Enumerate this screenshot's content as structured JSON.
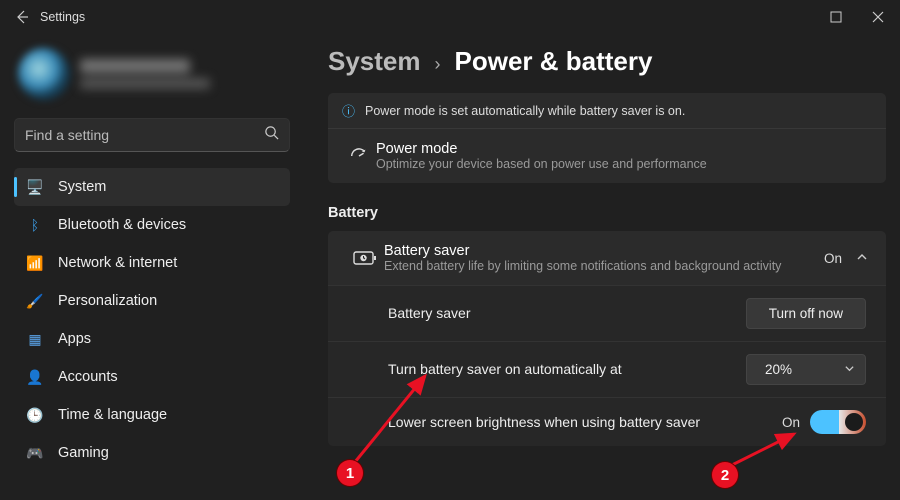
{
  "window": {
    "title": "Settings"
  },
  "search": {
    "placeholder": "Find a setting"
  },
  "nav": [
    {
      "label": "System",
      "icon": "🖥️",
      "color": "#4cc2ff",
      "selected": true
    },
    {
      "label": "Bluetooth & devices",
      "icon": "ᛒ",
      "color": "#3c9ee8",
      "selected": false
    },
    {
      "label": "Network & internet",
      "icon": "📶",
      "color": "#35b7c8",
      "selected": false
    },
    {
      "label": "Personalization",
      "icon": "🖌️",
      "color": "#c38a5b",
      "selected": false
    },
    {
      "label": "Apps",
      "icon": "▦",
      "color": "#5aa3e8",
      "selected": false
    },
    {
      "label": "Accounts",
      "icon": "👤",
      "color": "#8aa0b8",
      "selected": false
    },
    {
      "label": "Time & language",
      "icon": "🕒",
      "color": "#b0b0b0",
      "selected": false
    },
    {
      "label": "Gaming",
      "icon": "🎮",
      "color": "#b0b0b0",
      "selected": false
    }
  ],
  "breadcrumb": {
    "parent": "System",
    "current": "Power & battery"
  },
  "info_banner": "Power mode is set automatically while battery saver is on.",
  "power_mode": {
    "title": "Power mode",
    "subtitle": "Optimize your device based on power use and performance"
  },
  "section_battery": "Battery",
  "battery_saver": {
    "title": "Battery saver",
    "subtitle": "Extend battery life by limiting some notifications and background activity",
    "state": "On"
  },
  "rows": {
    "turn_off": {
      "label": "Battery saver",
      "button": "Turn off now"
    },
    "auto": {
      "label": "Turn battery saver on automatically at",
      "value": "20%"
    },
    "bright": {
      "label": "Lower screen brightness when using battery saver",
      "state": "On"
    }
  },
  "markers": {
    "one": "1",
    "two": "2"
  }
}
